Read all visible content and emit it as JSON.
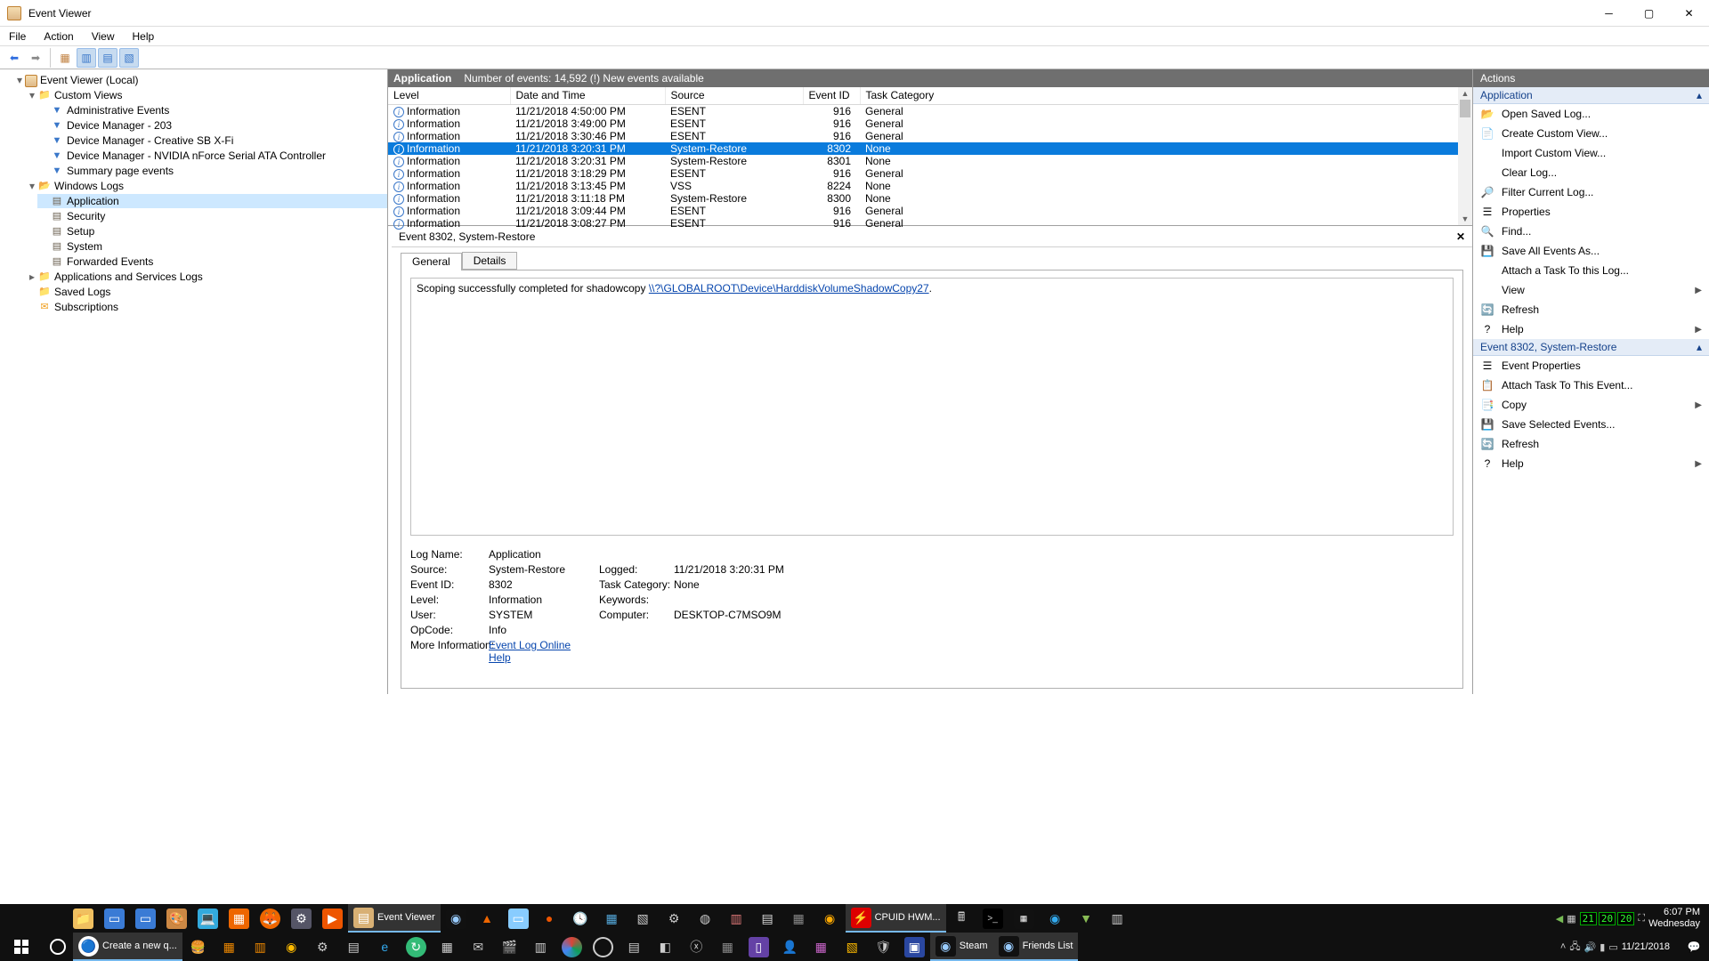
{
  "window": {
    "title": "Event Viewer"
  },
  "menu": [
    "File",
    "Action",
    "View",
    "Help"
  ],
  "tree": {
    "root": "Event Viewer (Local)",
    "customViews": "Custom Views",
    "customItems": [
      "Administrative Events",
      "Device Manager - 203",
      "Device Manager - Creative SB X-Fi",
      "Device Manager - NVIDIA nForce Serial ATA Controller",
      "Summary page events"
    ],
    "winLogs": "Windows Logs",
    "winLogItems": [
      "Application",
      "Security",
      "Setup",
      "System",
      "Forwarded Events"
    ],
    "appsSvc": "Applications and Services Logs",
    "saved": "Saved Logs",
    "subs": "Subscriptions"
  },
  "mid": {
    "title": "Application",
    "count": "Number of events: 14,592 (!) New events available",
    "cols": [
      "Level",
      "Date and Time",
      "Source",
      "Event ID",
      "Task Category"
    ],
    "rows": [
      {
        "level": "Information",
        "dt": "11/21/2018 4:50:00 PM",
        "src": "ESENT",
        "id": "916",
        "tc": "General"
      },
      {
        "level": "Information",
        "dt": "11/21/2018 3:49:00 PM",
        "src": "ESENT",
        "id": "916",
        "tc": "General"
      },
      {
        "level": "Information",
        "dt": "11/21/2018 3:30:46 PM",
        "src": "ESENT",
        "id": "916",
        "tc": "General"
      },
      {
        "level": "Information",
        "dt": "11/21/2018 3:20:31 PM",
        "src": "System-Restore",
        "id": "8302",
        "tc": "None"
      },
      {
        "level": "Information",
        "dt": "11/21/2018 3:20:31 PM",
        "src": "System-Restore",
        "id": "8301",
        "tc": "None"
      },
      {
        "level": "Information",
        "dt": "11/21/2018 3:18:29 PM",
        "src": "ESENT",
        "id": "916",
        "tc": "General"
      },
      {
        "level": "Information",
        "dt": "11/21/2018 3:13:45 PM",
        "src": "VSS",
        "id": "8224",
        "tc": "None"
      },
      {
        "level": "Information",
        "dt": "11/21/2018 3:11:18 PM",
        "src": "System-Restore",
        "id": "8300",
        "tc": "None"
      },
      {
        "level": "Information",
        "dt": "11/21/2018 3:09:44 PM",
        "src": "ESENT",
        "id": "916",
        "tc": "General"
      },
      {
        "level": "Information",
        "dt": "11/21/2018 3:08:27 PM",
        "src": "ESENT",
        "id": "916",
        "tc": "General"
      }
    ]
  },
  "detail": {
    "header": "Event 8302, System-Restore",
    "tabGeneral": "General",
    "tabDetails": "Details",
    "messagePre": "Scoping successfully completed for shadowcopy ",
    "messageLink": "\\\\?\\GLOBALROOT\\Device\\HarddiskVolumeShadowCopy27",
    "messagePost": ".",
    "props": {
      "LogName": "Application",
      "Source": "System-Restore",
      "Logged": "11/21/2018 3:20:31 PM",
      "EventID": "8302",
      "TaskCategory": "None",
      "Level": "Information",
      "Keywords": "",
      "User": "SYSTEM",
      "Computer": "DESKTOP-C7MSO9M",
      "OpCode": "Info",
      "MoreInfoLabel": "More Information:",
      "MoreInfoLink": "Event Log Online Help"
    }
  },
  "actions": {
    "header": "Actions",
    "group1": "Application",
    "list1": [
      {
        "i": "📂",
        "t": "Open Saved Log..."
      },
      {
        "i": "📄",
        "t": "Create Custom View..."
      },
      {
        "i": "",
        "t": "Import Custom View..."
      },
      {
        "i": "",
        "t": "Clear Log..."
      },
      {
        "i": "🔎",
        "t": "Filter Current Log..."
      },
      {
        "i": "☰",
        "t": "Properties"
      },
      {
        "i": "🔍",
        "t": "Find..."
      },
      {
        "i": "💾",
        "t": "Save All Events As..."
      },
      {
        "i": "",
        "t": "Attach a Task To this Log..."
      },
      {
        "i": "",
        "t": "View",
        "sub": true
      },
      {
        "i": "🔄",
        "t": "Refresh"
      },
      {
        "i": "?",
        "t": "Help",
        "sub": true
      }
    ],
    "group2": "Event 8302, System-Restore",
    "list2": [
      {
        "i": "☰",
        "t": "Event Properties"
      },
      {
        "i": "📋",
        "t": "Attach Task To This Event..."
      },
      {
        "i": "📑",
        "t": "Copy",
        "sub": true
      },
      {
        "i": "💾",
        "t": "Save Selected Events..."
      },
      {
        "i": "🔄",
        "t": "Refresh"
      },
      {
        "i": "?",
        "t": "Help",
        "sub": true
      }
    ]
  },
  "taskbar": {
    "eventViewer": "Event Viewer",
    "hwmonitor": "CPUID HWM...",
    "steam": "Steam",
    "friends": "Friends List",
    "create": "Create a new q...",
    "gpu": [
      "21",
      "20",
      "20"
    ],
    "time": "6:07 PM",
    "day": "Wednesday",
    "date": "11/21/2018"
  }
}
